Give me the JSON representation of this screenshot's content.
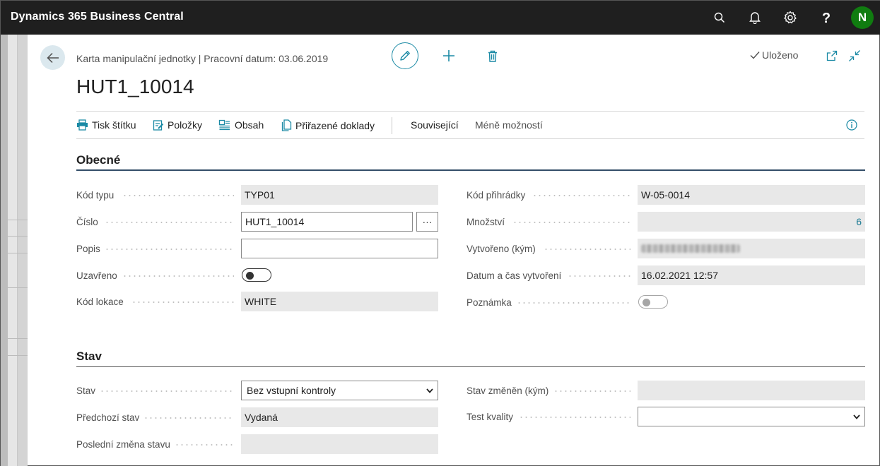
{
  "app": {
    "title": "Dynamics 365 Business Central",
    "avatar_initial": "N"
  },
  "icons": {
    "search": "search-icon",
    "bell": "bell-icon",
    "settings": "gear-icon",
    "help": "help-icon",
    "back": "arrow-left-icon",
    "edit": "pencil-icon",
    "new": "plus-icon",
    "delete": "trash-icon",
    "saved": "checkmark-icon",
    "open_new": "open-in-new-window-icon",
    "collapse": "collapse-icon",
    "info": "info-icon"
  },
  "header": {
    "breadcrumb": "Karta manipulační jednotky | Pracovní datum: 03.06.2019",
    "title": "HUT1_10014",
    "saved_label": "Uloženo"
  },
  "actions": {
    "print_label": "Tisk štítku",
    "items_label": "Položky",
    "content_label": "Obsah",
    "assigned_docs_label": "Přiřazené doklady",
    "related_label": "Související",
    "fewer_options_label": "Méně možností"
  },
  "general": {
    "title": "Obecné",
    "type_code": {
      "label": "Kód typu",
      "value": "TYP01"
    },
    "number": {
      "label": "Číslo",
      "value": "HUT1_10014"
    },
    "description": {
      "label": "Popis",
      "value": ""
    },
    "closed": {
      "label": "Uzavřeno",
      "value": false
    },
    "location_code": {
      "label": "Kód lokace",
      "value": "WHITE"
    },
    "bin_code": {
      "label": "Kód přihrádky",
      "value": "W-05-0014"
    },
    "quantity": {
      "label": "Množství",
      "value": "6"
    },
    "created_by": {
      "label": "Vytvořeno (kým)"
    },
    "created_at": {
      "label": "Datum a čas vytvoření",
      "value": "16.02.2021 12:57"
    },
    "note": {
      "label": "Poznámka",
      "value": false
    },
    "ellipsis": "···"
  },
  "status": {
    "title": "Stav",
    "state": {
      "label": "Stav",
      "value": "Bez vstupní kontroly"
    },
    "previous_state": {
      "label": "Předchozí stav",
      "value": "Vydaná"
    },
    "last_change": {
      "label": "Poslední změna stavu",
      "value": ""
    },
    "changed_by": {
      "label": "Stav změněn (kým)",
      "value": ""
    },
    "quality_test": {
      "label": "Test kvality",
      "value": ""
    }
  },
  "colors": {
    "accent": "#1b8aa5",
    "topbar": "#1f1f1f",
    "avatar": "#107c10",
    "section_line": "#334e68"
  }
}
